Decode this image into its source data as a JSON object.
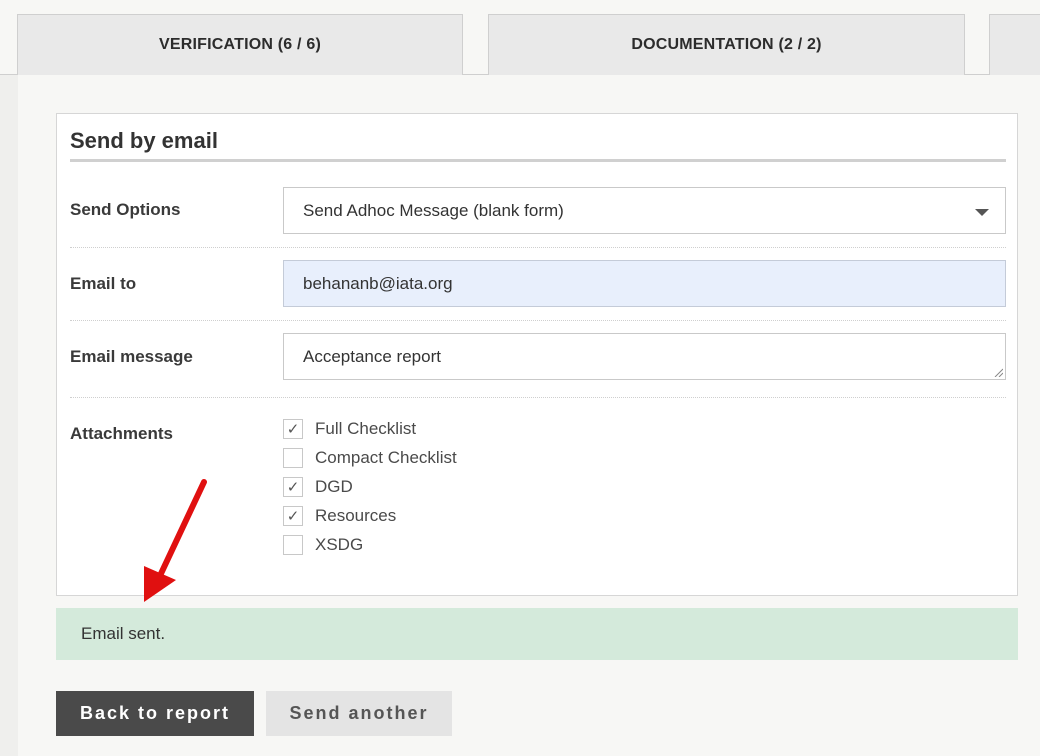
{
  "tabs": [
    {
      "label": "VERIFICATION (6 / 6)"
    },
    {
      "label": "DOCUMENTATION (2 / 2)"
    },
    {
      "label": ""
    }
  ],
  "panel": {
    "title": "Send by email",
    "send_options": {
      "label": "Send Options",
      "value": "Send Adhoc Message (blank form)"
    },
    "email_to": {
      "label": "Email to",
      "value": "behananb@iata.org"
    },
    "email_message": {
      "label": "Email message",
      "value": "Acceptance report"
    },
    "attachments": {
      "label": "Attachments",
      "items": [
        {
          "label": "Full Checklist",
          "checked": true,
          "mark": "✓"
        },
        {
          "label": "Compact Checklist",
          "checked": false,
          "mark": ""
        },
        {
          "label": "DGD",
          "checked": true,
          "mark": "✓"
        },
        {
          "label": "Resources",
          "checked": true,
          "mark": "✓"
        },
        {
          "label": "XSDG",
          "checked": false,
          "mark": ""
        }
      ]
    }
  },
  "status": {
    "message": "Email sent.",
    "color": "#d4eadb"
  },
  "buttons": {
    "back": "Back to report",
    "send_another": "Send another"
  },
  "annotation": {
    "icon": "red-arrow-icon",
    "color": "#e01010"
  }
}
